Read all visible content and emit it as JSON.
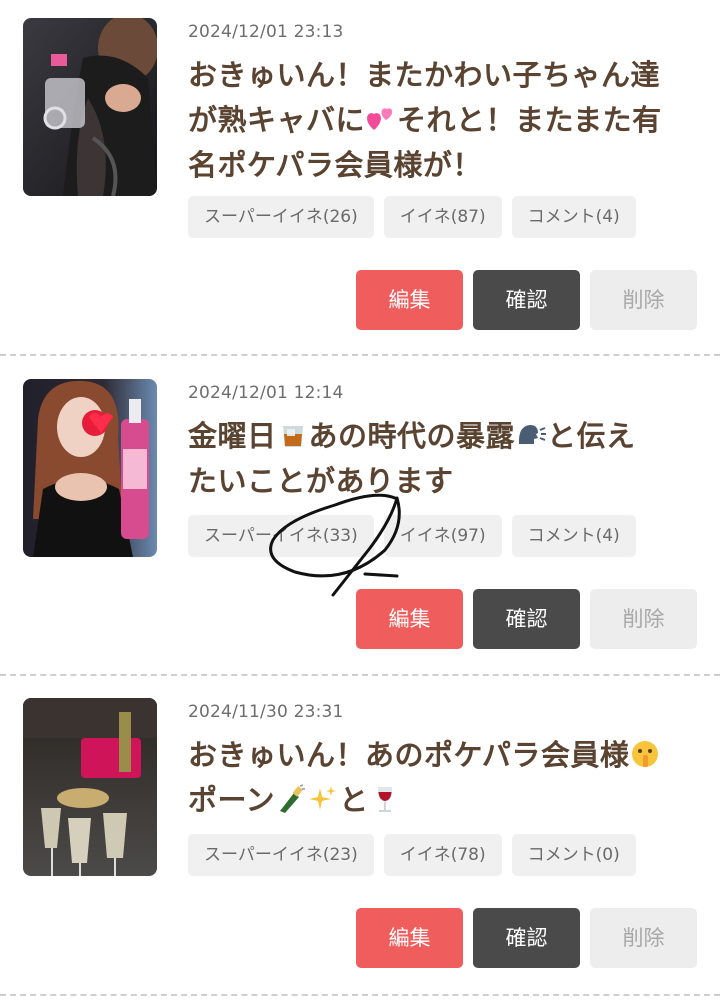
{
  "posts": [
    {
      "date": "2024/12/01 23:13",
      "title_lines": [
        "おきゅいん！またかわい子ちゃん達",
        "が熟キャバに",
        "それと！またまた有",
        "名ポケパラ会員様が！"
      ],
      "stats": {
        "super_like": "スーパーイイネ(26)",
        "like": "イイネ(87)",
        "comment": "コメント(4)"
      },
      "emojis": [
        "two-hearts"
      ]
    },
    {
      "date": "2024/12/01 12:14",
      "title_lines": [
        "金曜日",
        "あの時代の暴露",
        "と伝え",
        "たいことがあります"
      ],
      "stats": {
        "super_like": "スーパーイイネ(33)",
        "like": "イイネ(97)",
        "comment": "コメント(4)"
      },
      "emojis": [
        "whisky-glass",
        "speaking-head"
      ]
    },
    {
      "date": "2024/11/30 23:31",
      "title_lines": [
        "おきゅいん！あのポケパラ会員様",
        "ポーン",
        "と"
      ],
      "stats": {
        "super_like": "スーパーイイネ(23)",
        "like": "イイネ(78)",
        "comment": "コメント(0)"
      },
      "emojis": [
        "shushing-face",
        "champagne-bottle",
        "sparkles",
        "wine-glass"
      ]
    }
  ],
  "actions": {
    "edit": "編集",
    "confirm": "確認",
    "delete": "削除"
  },
  "colors": {
    "edit": "#ef5d5d",
    "confirm": "#4a4a4a",
    "delete": "#ededed",
    "title": "#5a4330",
    "stat_bg": "#f0f0f0"
  }
}
